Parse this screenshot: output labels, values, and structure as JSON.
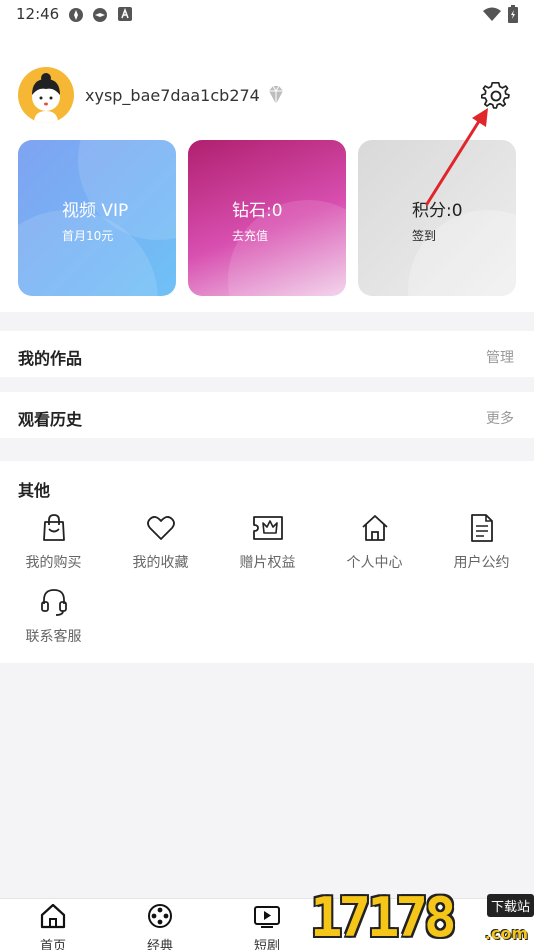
{
  "status_bar": {
    "time": "12:46"
  },
  "profile": {
    "username": "xysp_bae7daa1cb274"
  },
  "cards": [
    {
      "title": "视频 VIP",
      "subtitle": "首月10元"
    },
    {
      "title": "钻石:0",
      "subtitle": "去充值"
    },
    {
      "title": "积分:0",
      "subtitle": "签到"
    }
  ],
  "rows": {
    "works": {
      "label": "我的作品",
      "action": "管理"
    },
    "history": {
      "label": "观看历史",
      "action": "更多"
    }
  },
  "other": {
    "heading": "其他",
    "items": [
      {
        "label": "我的购买",
        "icon": "shopping-bag-icon"
      },
      {
        "label": "我的收藏",
        "icon": "heart-icon"
      },
      {
        "label": "赠片权益",
        "icon": "crown-ticket-icon"
      },
      {
        "label": "个人中心",
        "icon": "home-icon"
      },
      {
        "label": "用户公约",
        "icon": "document-icon"
      },
      {
        "label": "联系客服",
        "icon": "headset-icon"
      }
    ]
  },
  "tabbar": {
    "tabs": [
      {
        "label": "首页",
        "icon": "home-icon"
      },
      {
        "label": "经典",
        "icon": "film-reel-icon"
      },
      {
        "label": "短剧",
        "icon": "tv-play-icon"
      }
    ]
  },
  "watermark": {
    "number": "17178",
    "tag": "下载站",
    "suffix": ".com"
  },
  "colors": {
    "annotation_arrow": "#e0262b",
    "avatar_bg": "#f6b734",
    "watermark": "#f5c518"
  }
}
